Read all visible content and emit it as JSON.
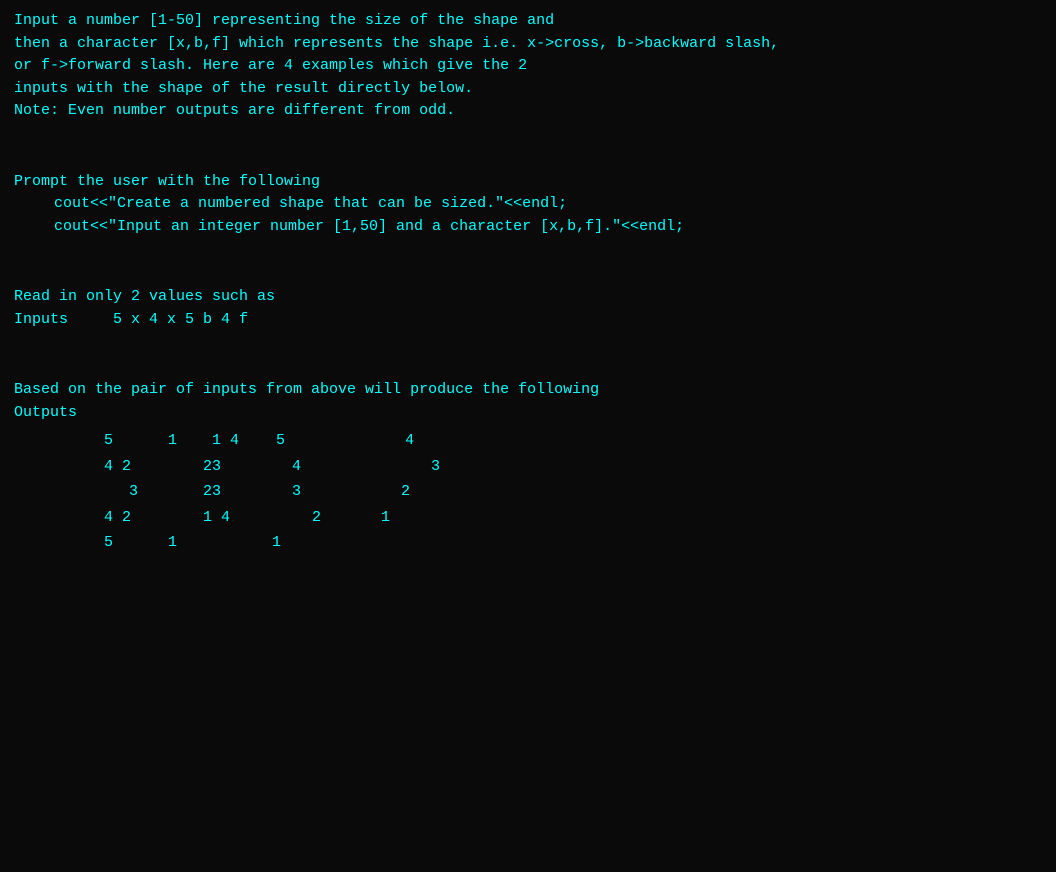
{
  "intro": {
    "line1": "Input a number [1-50] representing the size of the shape and",
    "line2": "then a character [x,b,f] which represents the shape i.e. x->cross, b->backward slash,",
    "line3": "or f->forward slash.  Here are 4 examples which give the 2",
    "line4": "inputs with the shape of the result directly below.",
    "line5": "Note:  Even number outputs are different from odd."
  },
  "prompt_section": {
    "header": "Prompt the user with the following",
    "line1": "cout<<\"Create a numbered shape that can be sized.\"<<endl;",
    "line2": "cout<<\"Input an integer number [1,50] and a character [x,b,f].\"<<endl;"
  },
  "read_section": {
    "header": "Read in only 2 values such as",
    "inputs_label": "Inputs",
    "inputs_values": "5 x        4 x        5 b        4 f"
  },
  "based_section": {
    "header": "Based on the pair of inputs from above will produce the following",
    "outputs_label": "Outputs",
    "rows": [
      {
        "cols": [
          "5",
          "1",
          "  1",
          "4",
          "   5",
          "            4"
        ]
      },
      {
        "cols": [
          "  4 2",
          "     23",
          "      4",
          "           3"
        ]
      },
      {
        "cols": [
          "    3",
          "      23",
          "       3",
          "      2"
        ]
      },
      {
        "cols": [
          "  4 2",
          "     1",
          "4",
          "         2",
          "  1"
        ]
      },
      {
        "cols": [
          "5",
          "1",
          "              1",
          ""
        ]
      }
    ]
  },
  "colors": {
    "cyan": "#00ffff",
    "white": "#ffffff",
    "bg": "#0a0a0a"
  }
}
